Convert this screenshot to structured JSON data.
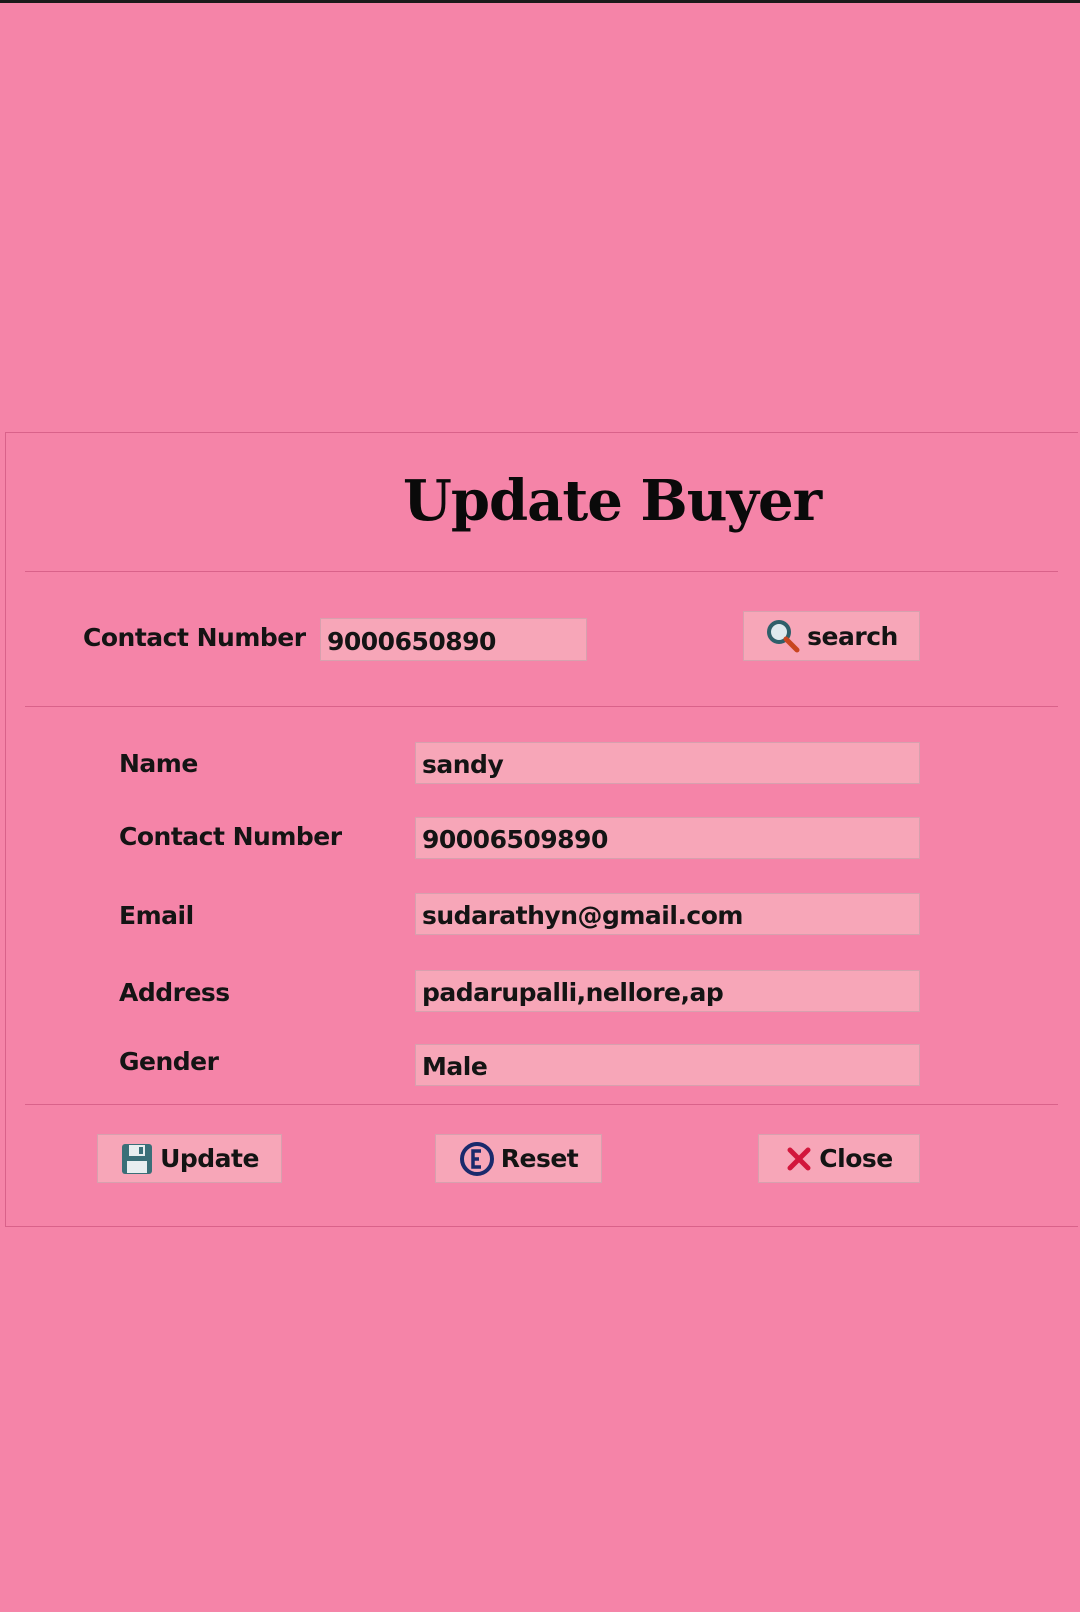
{
  "window": {
    "title": "Update Buyer"
  },
  "search": {
    "label": "Contact Number",
    "value": "9000650890",
    "button_label": "search",
    "button_icon": "search-icon"
  },
  "form": {
    "name": {
      "label": "Name",
      "value": "sandy"
    },
    "contact": {
      "label": "Contact Number",
      "value": "90006509890"
    },
    "email": {
      "label": "Email",
      "value": "sudarathyn@gmail.com"
    },
    "address": {
      "label": "Address",
      "value": "padarupalli,nellore,ap"
    },
    "gender": {
      "label": "Gender",
      "value": "Male"
    }
  },
  "actions": {
    "update": {
      "label": "Update",
      "icon": "save-icon"
    },
    "reset": {
      "label": "Reset",
      "icon": "reset-icon"
    },
    "close": {
      "label": "Close",
      "icon": "close-icon"
    }
  },
  "colors": {
    "background": "#f584a8",
    "field_background": "#f7a6b8",
    "close_icon": "#d2163c",
    "save_icon": "#3a6f78"
  }
}
